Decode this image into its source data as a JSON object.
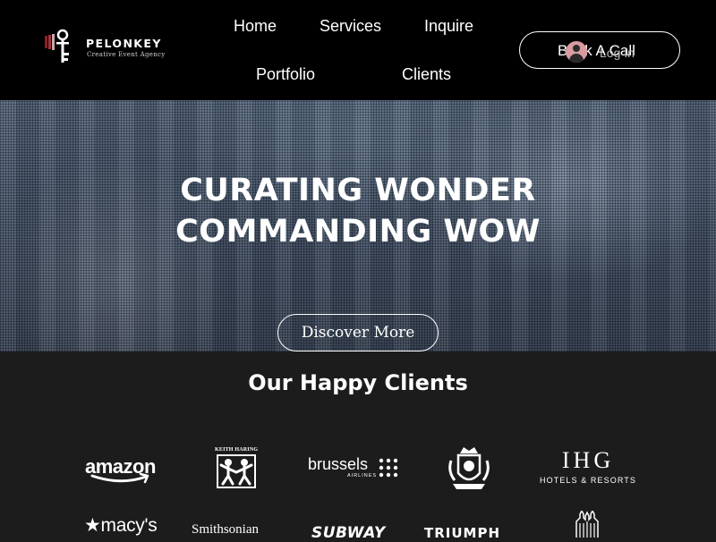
{
  "header": {
    "logo": {
      "name": "PELONKEY",
      "tagline": "Creative Event Agency",
      "icon": "key-icon"
    },
    "nav": [
      {
        "label": "Home"
      },
      {
        "label": "Services"
      },
      {
        "label": "Inquire"
      },
      {
        "label": "Portfolio"
      },
      {
        "label": "Clients"
      }
    ],
    "book_call": "Book A Call",
    "login": {
      "label": "Log In",
      "icon": "avatar-icon"
    }
  },
  "hero": {
    "title_line1": "CURATING WONDER",
    "title_line2": "COMMANDING WOW",
    "button": "Discover More"
  },
  "clients": {
    "title": "Our Happy Clients",
    "logos": {
      "amazon": "amazon",
      "keith_haring": "KEITH HARING",
      "brussels": "brussels",
      "brussels_sub": "AIRLINES",
      "ihg": "IHG",
      "ihg_sub": "HOTELS & RESORTS",
      "macys": "★macy's",
      "smithsonian": "Smithsonian",
      "subway": "SUBWAY",
      "triumph": "TRIUMPH"
    }
  },
  "colors": {
    "header_bg": "#000000",
    "section_bg": "#1c1c1c",
    "text": "#ffffff",
    "avatar": "#d99aa0"
  }
}
